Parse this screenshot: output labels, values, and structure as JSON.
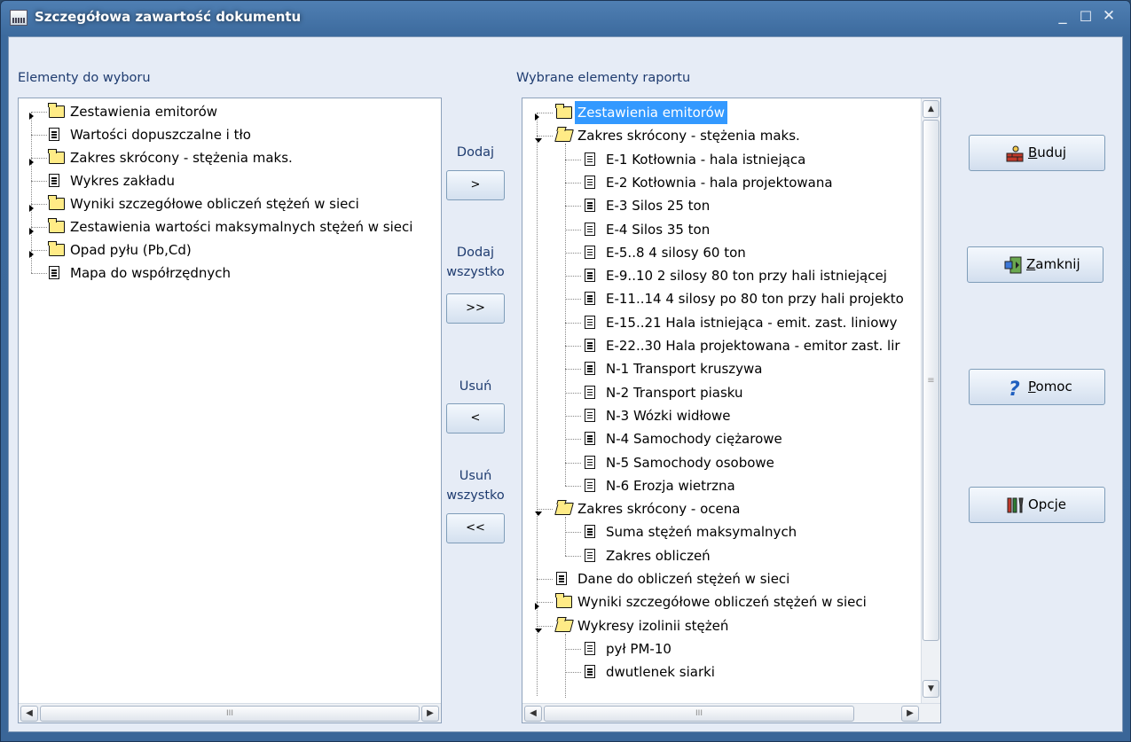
{
  "window": {
    "title": "Szczegółowa zawartość dokumentu",
    "controls": [
      "_",
      "☐",
      "✕"
    ]
  },
  "left_panel": {
    "label": "Elementy do wyboru",
    "items": [
      {
        "label": "Zestawienia emitorów",
        "icon": "folder-icon",
        "expand": "closed"
      },
      {
        "label": "Wartości dopuszczalne i tło",
        "icon": "document-icon",
        "expand": "none"
      },
      {
        "label": "Zakres skrócony - stężenia maks.",
        "icon": "folder-icon",
        "expand": "closed"
      },
      {
        "label": "Wykres zakładu",
        "icon": "document-icon",
        "expand": "none"
      },
      {
        "label": "Wyniki szczegółowe obliczeń stężeń w sieci",
        "icon": "folder-icon",
        "expand": "closed"
      },
      {
        "label": "Zestawienia wartości maksymalnych stężeń w sieci",
        "icon": "folder-icon",
        "expand": "closed"
      },
      {
        "label": "Opad pyłu (Pb,Cd)",
        "icon": "folder-icon",
        "expand": "closed"
      },
      {
        "label": "Mapa do współrzędnych",
        "icon": "document-icon",
        "expand": "none"
      }
    ]
  },
  "middle": {
    "add_label": "Dodaj",
    "add_btn": ">",
    "add_all_label_1": "Dodaj",
    "add_all_label_2": "wszystko",
    "add_all_btn": ">>",
    "remove_label": "Usuń",
    "remove_btn": "<",
    "remove_all_label_1": "Usuń",
    "remove_all_label_2": "wszystko",
    "remove_all_btn": "<<"
  },
  "right_panel": {
    "label": "Wybrane elementy raportu",
    "items": [
      {
        "label": "Zestawienia emitorów",
        "icon": "folder-icon",
        "level": 0,
        "expand": "closed",
        "selected": true
      },
      {
        "label": "Zakres skrócony - stężenia maks.",
        "icon": "folder-open-icon",
        "level": 0,
        "expand": "open"
      },
      {
        "label": "E-1 Kotłownia - hala istniejąca",
        "icon": "document-icon",
        "level": 1
      },
      {
        "label": "E-2 Kotłownia - hala projektowana",
        "icon": "document-icon",
        "level": 1
      },
      {
        "label": "E-3 Silos 25 ton",
        "icon": "document-icon",
        "level": 1
      },
      {
        "label": "E-4 Silos 35 ton",
        "icon": "document-icon",
        "level": 1
      },
      {
        "label": "E-5..8 4 silosy 60 ton",
        "icon": "document-icon",
        "level": 1
      },
      {
        "label": "E-9..10 2 silosy 80 ton przy hali istniejącej",
        "icon": "document-icon",
        "level": 1
      },
      {
        "label": "E-11..14 4 silosy po 80 ton przy hali projekto",
        "icon": "document-icon",
        "level": 1
      },
      {
        "label": "E-15..21 Hala istniejąca - emit. zast. liniowy",
        "icon": "document-icon",
        "level": 1
      },
      {
        "label": "E-22..30 Hala projektowana - emitor zast. lir",
        "icon": "document-icon",
        "level": 1
      },
      {
        "label": "N-1 Transport kruszywa",
        "icon": "document-icon",
        "level": 1
      },
      {
        "label": "N-2 Transport piasku",
        "icon": "document-icon",
        "level": 1
      },
      {
        "label": "N-3 Wózki widłowe",
        "icon": "document-icon",
        "level": 1
      },
      {
        "label": "N-4 Samochody ciężarowe",
        "icon": "document-icon",
        "level": 1
      },
      {
        "label": "N-5 Samochody osobowe",
        "icon": "document-icon",
        "level": 1
      },
      {
        "label": "N-6 Erozja wietrzna",
        "icon": "document-icon",
        "level": 1
      },
      {
        "label": "Zakres skrócony - ocena",
        "icon": "folder-open-icon",
        "level": 0,
        "expand": "open"
      },
      {
        "label": "Suma stężeń maksymalnych",
        "icon": "document-icon",
        "level": 1
      },
      {
        "label": "Zakres obliczeń",
        "icon": "document-icon",
        "level": 1
      },
      {
        "label": "Dane do obliczeń stężeń w sieci",
        "icon": "document-icon",
        "level": 0
      },
      {
        "label": "Wyniki szczegółowe obliczeń stężeń w sieci",
        "icon": "folder-icon",
        "level": 0,
        "expand": "closed"
      },
      {
        "label": "Wykresy izolinii stężeń",
        "icon": "folder-open-icon",
        "level": 0,
        "expand": "open"
      },
      {
        "label": "pył PM-10",
        "icon": "document-icon",
        "level": 1
      },
      {
        "label": "dwutlenek siarki",
        "icon": "document-icon",
        "level": 1
      }
    ]
  },
  "actions": {
    "build": {
      "label": "Buduj",
      "hotkey": "B",
      "rest": "uduj",
      "icon": "build-icon"
    },
    "close": {
      "label": "Zamknij",
      "hotkey": "Z",
      "rest": "amknij",
      "icon": "exit-door-icon"
    },
    "help": {
      "label": "Pomoc",
      "hotkey": "P",
      "rest": "omoc",
      "icon": "question-icon"
    },
    "options": {
      "label": "Opcje",
      "icon": "tools-icon"
    }
  },
  "scroll": {
    "thumb_grip": "III",
    "left_arrow": "◀",
    "right_arrow": "▶",
    "up_arrow": "▲",
    "down_arrow": "▼",
    "vgrip": "≡"
  }
}
